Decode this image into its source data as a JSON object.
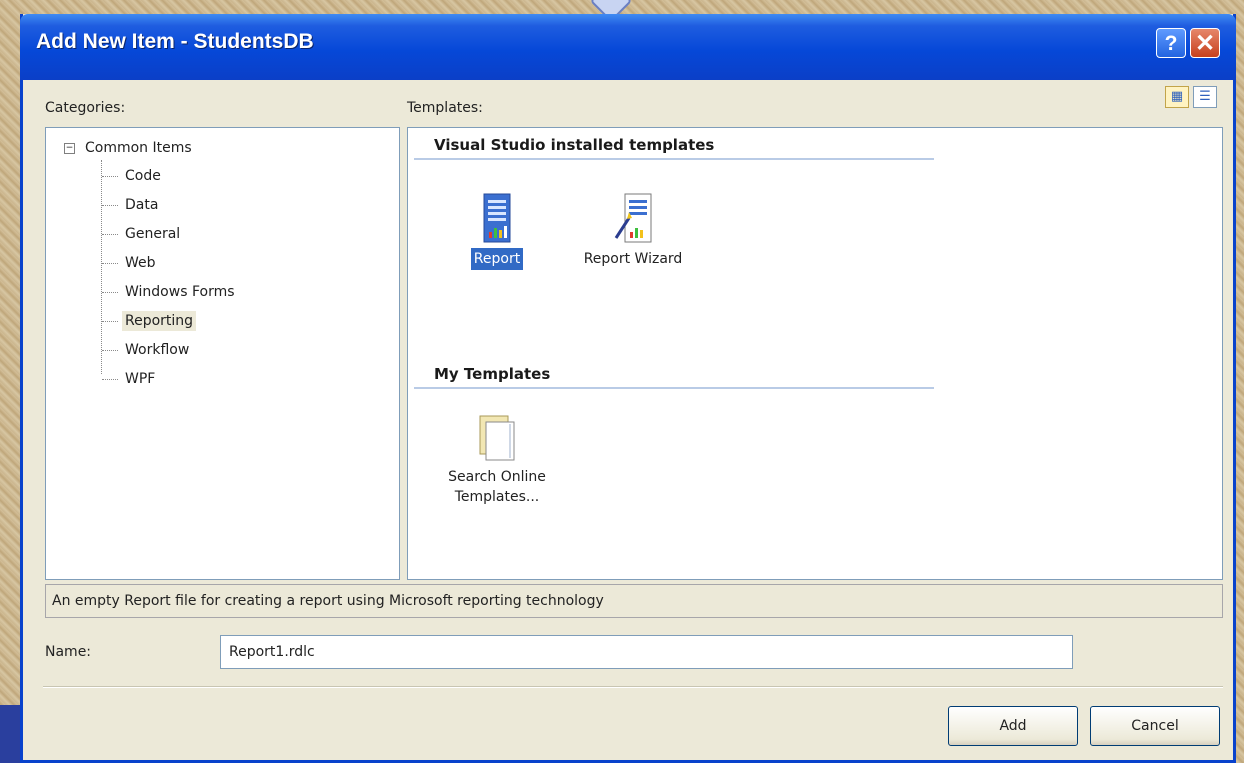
{
  "dialog": {
    "title": "Add New Item - StudentsDB"
  },
  "titlebar": {
    "help_label": "?",
    "close_label": "✕"
  },
  "labels": {
    "categories": "Categories:",
    "templates": "Templates:",
    "name": "Name:"
  },
  "view_buttons": [
    {
      "name": "large-icons-view",
      "icon": "large-icons-icon",
      "glyph": "▦"
    },
    {
      "name": "small-icons-view",
      "icon": "small-icons-icon",
      "glyph": "☰"
    }
  ],
  "categories": {
    "root": {
      "label": "Common Items",
      "toggle": "−"
    },
    "items": [
      "Code",
      "Data",
      "General",
      "Web",
      "Windows Forms",
      "Reporting",
      "Workflow",
      "WPF"
    ],
    "selected": "Reporting"
  },
  "templates": {
    "installed_header": "Visual Studio installed templates",
    "installed": [
      {
        "label": "Report",
        "icon": "report-icon",
        "selected": true
      },
      {
        "label": "Report Wizard",
        "icon": "report-wizard-icon",
        "selected": false
      }
    ],
    "my_header": "My Templates",
    "my": [
      {
        "label": "Search Online Templates...",
        "line1": "Search Online",
        "line2": "Templates...",
        "icon": "search-online-templates-icon"
      }
    ]
  },
  "description": "An empty Report file for creating a report using Microsoft reporting technology",
  "name_value": "Report1.rdlc",
  "buttons": {
    "add": "Add",
    "cancel": "Cancel"
  },
  "colors": {
    "titlebar": "#0648d8",
    "selection": "#316ac5",
    "dialog_bg": "#ece9d8"
  }
}
